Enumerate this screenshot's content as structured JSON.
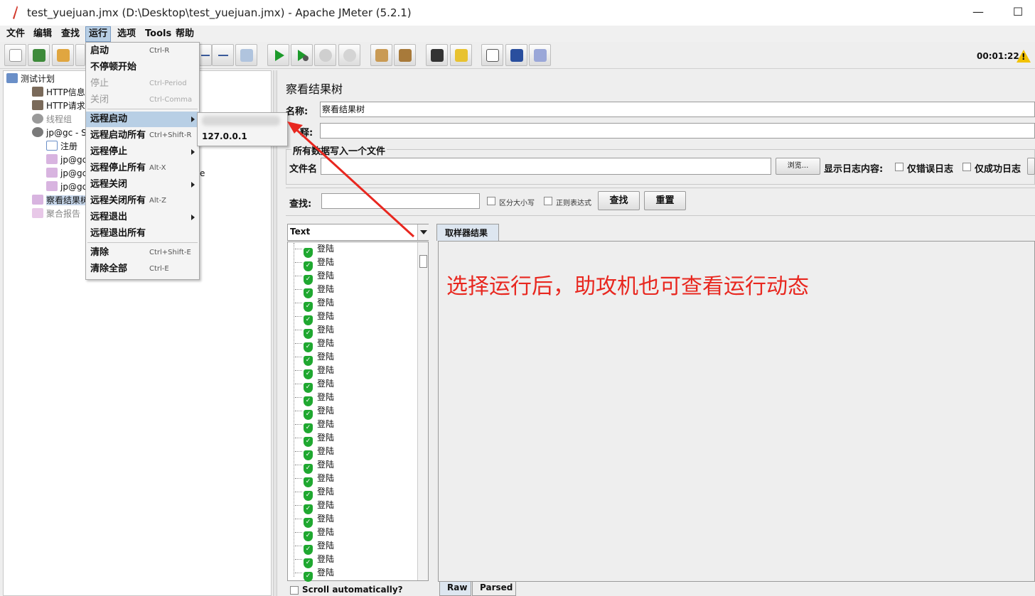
{
  "window": {
    "title": "test_yuejuan.jmx (D:\\Desktop\\test_yuejuan.jmx) - Apache JMeter (5.2.1)",
    "minimize": "—",
    "maximize": "☐"
  },
  "menubar": [
    "文件",
    "编辑",
    "查找",
    "运行",
    "选项",
    "Tools",
    "帮助"
  ],
  "toolbar": {
    "timer": "00:01:22"
  },
  "tree": [
    {
      "label": "测试计划",
      "icon": "test-plan-icon"
    },
    {
      "label": "HTTP信息",
      "icon": "wrench-icon"
    },
    {
      "label": "HTTP请求",
      "icon": "wrench-icon"
    },
    {
      "label": "线程组",
      "icon": "gear-icon"
    },
    {
      "label": "jp@gc - S",
      "icon": "gear-icon",
      "suffix": "e"
    },
    {
      "label": "注册",
      "icon": "controller-icon"
    },
    {
      "label": "jp@gc",
      "icon": "graph-icon"
    },
    {
      "label": "jp@gc",
      "icon": "graph-icon"
    },
    {
      "label": "jp@gc",
      "icon": "graph-icon"
    },
    {
      "label": "察看结果树",
      "icon": "graph-icon"
    },
    {
      "label": "聚合报告",
      "icon": "graph-icon"
    }
  ],
  "run_menu": [
    {
      "label": "启动",
      "shortcut": "Ctrl-R",
      "enabled": true
    },
    {
      "label": "不停顿开始",
      "shortcut": "",
      "enabled": true
    },
    {
      "label": "停止",
      "shortcut": "Ctrl-Period",
      "enabled": false
    },
    {
      "label": "关闭",
      "shortcut": "Ctrl-Comma",
      "enabled": false
    },
    {
      "label": "远程启动",
      "shortcut": "",
      "enabled": true,
      "submenu": true
    },
    {
      "label": "远程启动所有",
      "shortcut": "Ctrl+Shift-R",
      "enabled": true
    },
    {
      "label": "远程停止",
      "shortcut": "",
      "enabled": true,
      "submenu": true
    },
    {
      "label": "远程停止所有",
      "shortcut": "Alt-X",
      "enabled": true
    },
    {
      "label": "远程关闭",
      "shortcut": "",
      "enabled": true,
      "submenu": true
    },
    {
      "label": "远程关闭所有",
      "shortcut": "Alt-Z",
      "enabled": true
    },
    {
      "label": "远程退出",
      "shortcut": "",
      "enabled": true,
      "submenu": true
    },
    {
      "label": "远程退出所有",
      "shortcut": "",
      "enabled": true
    },
    {
      "label": "清除",
      "shortcut": "Ctrl+Shift-E",
      "enabled": true
    },
    {
      "label": "清除全部",
      "shortcut": "Ctrl-E",
      "enabled": true
    }
  ],
  "remote_submenu": [
    "127.0.0.1"
  ],
  "panel": {
    "title": "察看结果树",
    "name_label": "名称:",
    "name_value": "察看结果树",
    "comment_label": "释:",
    "file_section": "所有数据写入一个文件",
    "file_label": "文件名",
    "browse_button": "浏览...",
    "log_label": "显示日志内容:",
    "errors_only": "仅错误日志",
    "success_only": "仅成功日志",
    "search_label": "查找:",
    "case_sensitive": "区分大小写",
    "regex": "正则表达式",
    "search_button": "查找",
    "reset_button": "重置",
    "renderer": "Text",
    "result_tab": "取样器结果",
    "raw_tab": "Raw",
    "parsed_tab": "Parsed",
    "scroll_auto": "Scroll automatically?"
  },
  "samples": [
    "登陆",
    "登陆",
    "登陆",
    "登陆",
    "登陆",
    "登陆",
    "登陆",
    "登陆",
    "登陆",
    "登陆",
    "登陆",
    "登陆",
    "登陆",
    "登陆",
    "登陆",
    "登陆",
    "登陆",
    "登陆",
    "登陆",
    "登陆",
    "登陆",
    "登陆",
    "登陆",
    "登陆",
    "登陆"
  ],
  "annotation": "选择运行后，助攻机也可查看运行动态",
  "colors": {
    "accent": "#b8cfe5",
    "annotation": "#e8271f",
    "success": "#1fa830"
  }
}
